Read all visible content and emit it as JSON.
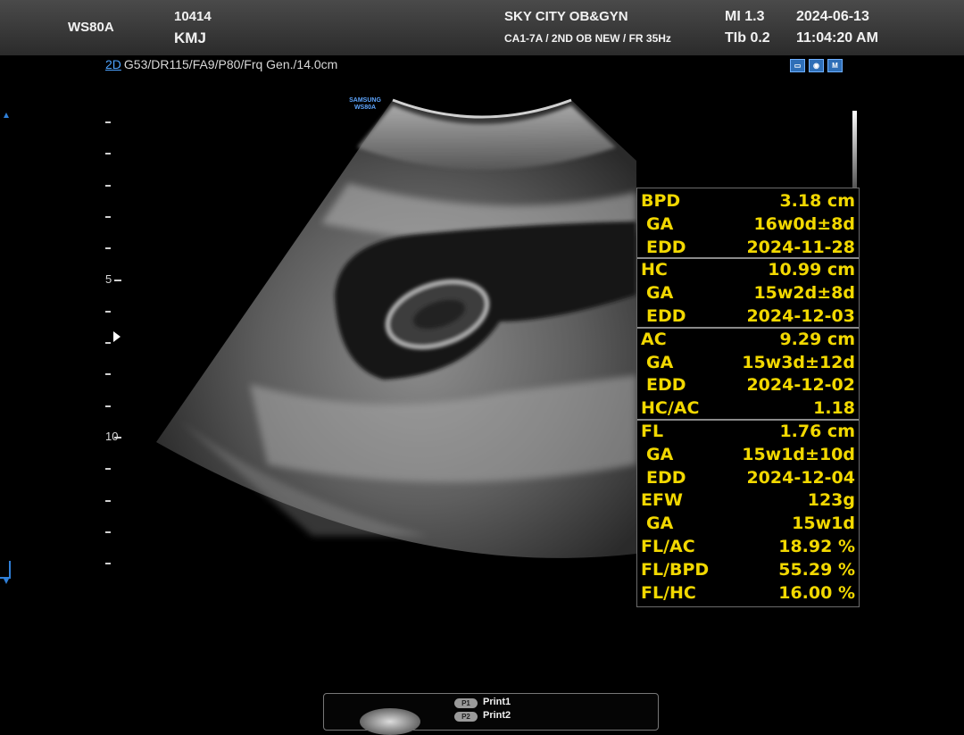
{
  "header": {
    "model": "WS80A",
    "patient_id": "10414",
    "patient_name": "KMJ",
    "institution": "SKY CITY OB&GYN",
    "probe_info": "CA1-7A / 2ND OB NEW / FR 35Hz",
    "mi": "MI  1.3",
    "tib": "TIb 0.2",
    "date": "2024-06-13",
    "time": "11:04:20 AM"
  },
  "imaging": {
    "mode": "2D",
    "params": "G53/DR115/FA9/P80/Frq Gen./14.0cm",
    "brand_tag_line1": "SAMSUNG",
    "brand_tag_line2": "WS80A"
  },
  "depth_scale": {
    "labels": [
      "5",
      "10"
    ]
  },
  "status_icons": [
    "monitor-icon",
    "camera-icon",
    "bookmark-icon"
  ],
  "measurements": [
    {
      "label": "BPD",
      "value": "3.18 cm",
      "sub": false
    },
    {
      "label": "GA",
      "value": "16w0d±8d",
      "sub": true
    },
    {
      "label": "EDD",
      "value": "2024-11-28",
      "sub": true,
      "sep": true
    },
    {
      "label": "HC",
      "value": "10.99 cm",
      "sub": false
    },
    {
      "label": "GA",
      "value": "15w2d±8d",
      "sub": true
    },
    {
      "label": "EDD",
      "value": "2024-12-03",
      "sub": true,
      "sep": true
    },
    {
      "label": "AC",
      "value": "9.29 cm",
      "sub": false
    },
    {
      "label": "GA",
      "value": "15w3d±12d",
      "sub": true
    },
    {
      "label": "EDD",
      "value": "2024-12-02",
      "sub": true
    },
    {
      "label": "HC/AC",
      "value": "1.18",
      "sub": false,
      "sep": true
    },
    {
      "label": "FL",
      "value": "1.76 cm",
      "sub": false
    },
    {
      "label": "GA",
      "value": "15w1d±10d",
      "sub": true
    },
    {
      "label": "EDD",
      "value": "2024-12-04",
      "sub": true
    },
    {
      "label": "EFW",
      "value": "123g",
      "sub": false
    },
    {
      "label": "GA",
      "value": "15w1d",
      "sub": true
    },
    {
      "label": "FL/AC",
      "value": "18.92 %",
      "sub": false
    },
    {
      "label": "FL/BPD",
      "value": "55.29 %",
      "sub": false
    },
    {
      "label": "FL/HC",
      "value": "16.00 %",
      "sub": false
    }
  ],
  "print": {
    "p1_badge": "P1",
    "p1_label": "Print1",
    "p2_badge": "P2",
    "p2_label": "Print2"
  },
  "colors": {
    "measure_text": "#f2d800",
    "accent": "#4da3ff"
  }
}
